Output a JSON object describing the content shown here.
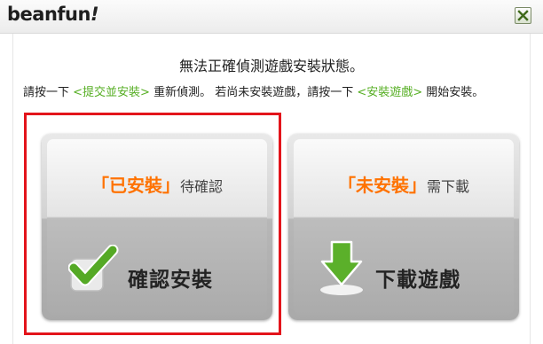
{
  "window": {
    "logo_main": "beanfun",
    "logo_mark": "!",
    "close_icon": "close-x-icon"
  },
  "main": {
    "headline": "無法正確偵測遊戲安裝狀態。",
    "instruction": {
      "part1": "請按一下 ",
      "link1": "<提交並安裝>",
      "part2": " 重新偵測。 若尚未安裝遊戲，請按一下 ",
      "link2": "<安裝遊戲>",
      "part3": " 開始安裝。"
    }
  },
  "options": {
    "installed": {
      "open_bracket": "「",
      "word": "已安裝",
      "close_bracket": "」",
      "tail": "待確認",
      "action": "確認安裝",
      "icon": "checkmark-icon"
    },
    "not_installed": {
      "open_bracket": "「",
      "word": "未安裝",
      "close_bracket": "」",
      "tail": "需下載",
      "action": "下載遊戲",
      "icon": "download-arrow-icon"
    }
  },
  "colors": {
    "accent_orange": "#ff7200",
    "link_green": "#55ae22",
    "highlight_red": "#e3141b"
  }
}
